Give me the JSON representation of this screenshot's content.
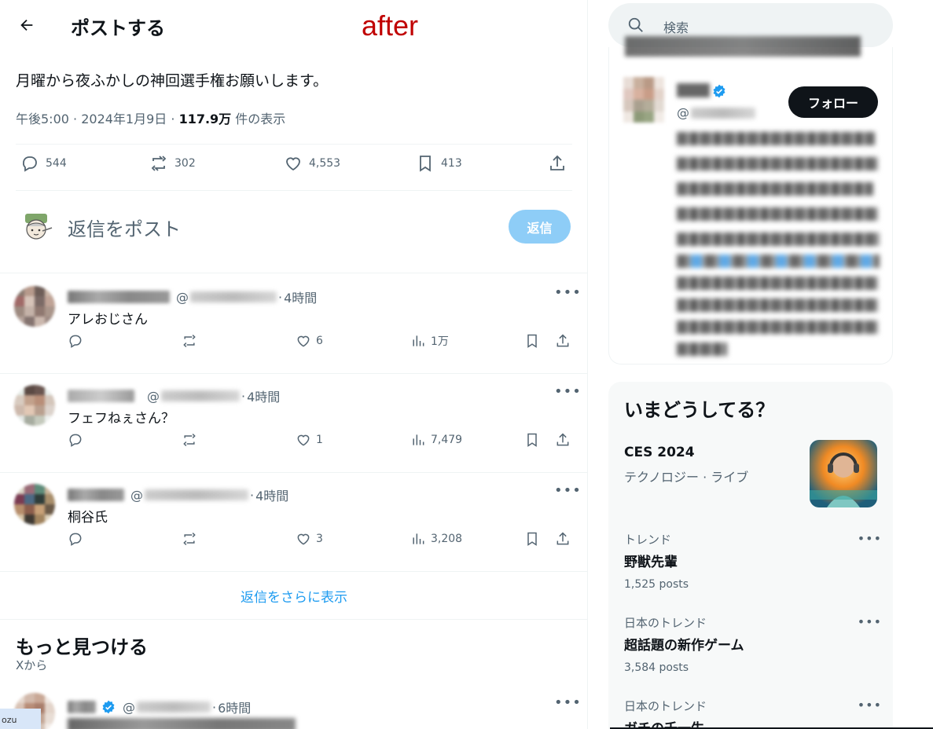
{
  "header": {
    "title": "ポストする",
    "overlay_label": "after"
  },
  "post": {
    "text": "月曜から夜ふかしの神回選手権お願いします。",
    "time": "午後5:00",
    "date": "2024年1月9日",
    "views": "117.9万",
    "views_suffix": "件の表示",
    "stats": {
      "replies": "544",
      "reposts": "302",
      "likes": "4,553",
      "bookmarks": "413"
    }
  },
  "reply_box": {
    "placeholder": "返信をポスト",
    "button": "返信"
  },
  "replies": [
    {
      "handle_prefix": "@",
      "time": "4時間",
      "text": "アレおじさん",
      "likes": "6",
      "views": "1万"
    },
    {
      "handle_prefix": "@",
      "time": "4時間",
      "text": "フェフねぇさん？",
      "likes": "1",
      "views": "7,479"
    },
    {
      "handle_prefix": "@",
      "time": "4時間",
      "text": "桐谷氏",
      "likes": "3",
      "views": "3,208"
    }
  ],
  "show_more": "返信をさらに表示",
  "discover": {
    "title": "もっと見つける",
    "subtitle": "Xから",
    "item": {
      "handle_prefix": "@",
      "time": "6時間"
    }
  },
  "bottom_badge": "ozu",
  "sidebar": {
    "search_placeholder": "検索",
    "related": {
      "handle_prefix": "@",
      "follow_label": "フォロー"
    },
    "trends": {
      "heading": "いまどうしてる？",
      "featured": {
        "title": "CES 2024",
        "subtitle": "テクノロジー · ライブ"
      },
      "items": [
        {
          "label": "トレンド",
          "name": "野獣先輩",
          "count": "1,525 posts"
        },
        {
          "label": "日本のトレンド",
          "name": "超話題の新作ゲーム",
          "count": "3,584 posts"
        },
        {
          "label": "日本のトレンド",
          "name": "ガチの千一生",
          "count": ""
        }
      ]
    }
  },
  "colors": {
    "accent": "#1d9bf0",
    "reply_button": "#8ecdf7",
    "text": "#0f1419",
    "muted": "#536471",
    "overlay_label": "#c00000"
  }
}
